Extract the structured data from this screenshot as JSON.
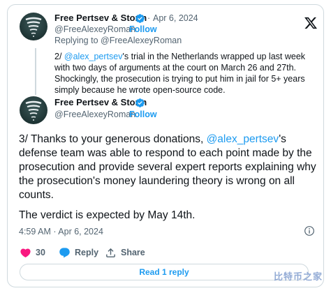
{
  "quoted_tweet": {
    "author_name": "Free Pertsev & Storm",
    "handle": "@FreeAlexeyRoman",
    "follow_label": "Follow",
    "date": "Apr 6, 2024",
    "replying_to": "Replying to @FreeAlexeyRoman",
    "text_prefix": "2/ ",
    "mention": "@alex_pertsev",
    "text_rest": "'s trial in the Netherlands wrapped up last week with two days of arguments at the court on March 26 and 27th. Shockingly, the prosecution is trying to put him in jail for 5+ years simply because he wrote open-source code."
  },
  "main_tweet": {
    "author_name": "Free Pertsev & Storm",
    "handle": "@FreeAlexeyRoman",
    "follow_label": "Follow",
    "text_prefix": "3/ Thanks to your generous donations, ",
    "mention": "@alex_pertsev",
    "text_rest": "'s defense team was able to respond to each point made by the prosecution and provide several expert reports explaining why the prosecution's money laundering theory is wrong on all counts.",
    "verdict": "The verdict is expected by May 14th.",
    "timestamp": "4:59 AM · Apr 6, 2024"
  },
  "actions": {
    "like_count": "30",
    "reply_label": "Reply",
    "share_label": "Share",
    "read_replies_label": "Read 1 reply"
  },
  "watermark_text": "比特币之家",
  "colors": {
    "accent": "#1d9bf0",
    "like": "#f91880",
    "secondary_text": "#536471",
    "border": "#cfd9de"
  },
  "icons": {
    "brand": "x-logo-icon",
    "verified": "verified-badge-icon",
    "info": "info-icon",
    "like": "heart-icon",
    "reply": "speech-bubble-icon",
    "share": "share-upload-icon"
  }
}
